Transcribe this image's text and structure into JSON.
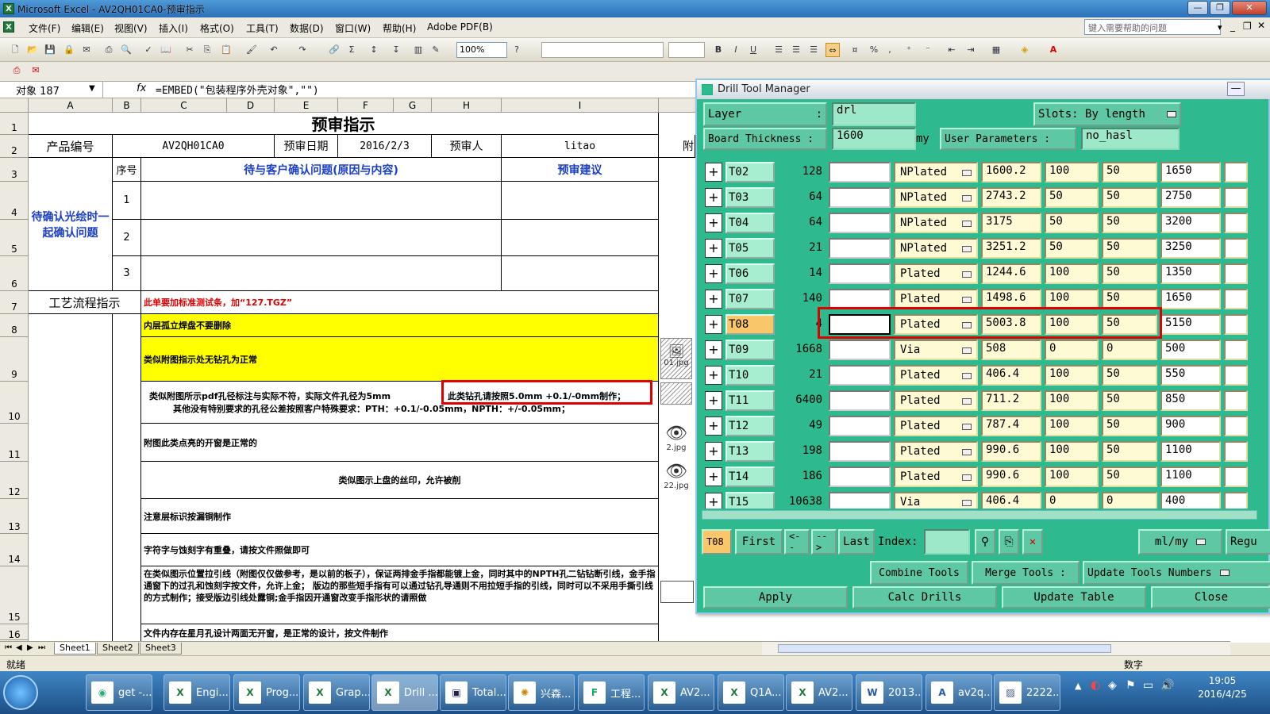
{
  "window": {
    "title": "Microsoft Excel - AV2QH01CA0-预审指示"
  },
  "menu": [
    "文件(F)",
    "编辑(E)",
    "视图(V)",
    "插入(I)",
    "格式(O)",
    "工具(T)",
    "数据(D)",
    "窗口(W)",
    "帮助(H)",
    "Adobe PDF(B)"
  ],
  "help_placeholder": "键入需要帮助的问题",
  "toolbar": {
    "zoom": "100%"
  },
  "formula_bar": {
    "name_box": "对象 187",
    "fx": "fx",
    "formula": "=EMBED(\"包装程序外壳对象\",\"\")"
  },
  "columns": [
    "A",
    "B",
    "C",
    "D",
    "E",
    "F",
    "G",
    "H",
    "I"
  ],
  "rows": [
    "1",
    "2",
    "3",
    "4",
    "5",
    "6",
    "7",
    "8",
    "9",
    "10",
    "11",
    "12",
    "13",
    "14",
    "15",
    "16"
  ],
  "sheet": {
    "title": "预审指示",
    "r2": {
      "label": "产品编号",
      "product": "AV2QH01CA0",
      "date_label": "预审日期",
      "date": "2016/2/3",
      "reviewer_label": "预审人",
      "reviewer": "litao",
      "cut": "附"
    },
    "r3": {
      "seq": "序号",
      "issues": "待与客户确认问题(原因与内容)",
      "advice": "预审建议"
    },
    "pending": "待确认光绘时一起确认问题",
    "seqs": [
      "1",
      "2",
      "3"
    ],
    "process_label": "工艺流程指示",
    "r7": "此单要加标准测试条，加“127.TGZ”",
    "r8": "内层孤立焊盘不要删除",
    "r9": "类似附图指示处无钻孔为正常",
    "r10a": "类似附图所示pdf孔径标注与实际不符，实际文件孔径为5mm",
    "r10b": "此类钻孔请按照5.0mm +0.1/-0mm制作；",
    "r10c": "其他没有特别要求的孔径公差按照客户特殊要求：PTH：+0.1/-0.05mm，NPTH：+/-0.05mm；",
    "r11": "附图此类点亮的开窗是正常的",
    "r12": "类似图示上盘的丝印，允许被削",
    "r13": "注意层标识按漏铜制作",
    "r14": "字符字与蚀刻字有重叠，请按文件照做即可",
    "r15": "在类似图示位置拉引线（附图仅仅做参考，是以前的板子），保证两排金手指都能镀上金，同时其中的NPTH孔二钻钻断引线，金手指通窗下的过孔和蚀刻字按文件，允许上金；  版边的那些短手指有可以通过钻孔导通则不用拉短手指的引线，同时可以不采用手撕引线的方式制作；接受版边引线处露铜;金手指因开通窗改变手指形状的请照做",
    "r16": "文件内存在星月孔设计两面无开窗，是正常的设计，按文件制作",
    "images": [
      "01.jpg",
      "2.jpg",
      "22.jpg"
    ]
  },
  "sheet_tabs": [
    "Sheet1",
    "Sheet2",
    "Sheet3"
  ],
  "status": {
    "left": "就绪",
    "right": "数字"
  },
  "dtm": {
    "title": "Drill Tool Manager",
    "layer_label": "Layer",
    "layer_value": "drl",
    "slots_label": "Slots:",
    "slots_value": "By length",
    "thickness_label": "Board Thickness :",
    "thickness_value": "1600",
    "thickness_unit": "my",
    "user_params_label": "User Parameters :",
    "user_params_value": "no_hasl",
    "tools": [
      {
        "name": "T02",
        "count": "128",
        "type": "NPlated",
        "size": "1600.2",
        "p": "100",
        "m": "50",
        "f": "1650"
      },
      {
        "name": "T03",
        "count": "64",
        "type": "NPlated",
        "size": "2743.2",
        "p": "50",
        "m": "50",
        "f": "2750"
      },
      {
        "name": "T04",
        "count": "64",
        "type": "NPlated",
        "size": "3175",
        "p": "50",
        "m": "50",
        "f": "3200"
      },
      {
        "name": "T05",
        "count": "21",
        "type": "NPlated",
        "size": "3251.2",
        "p": "50",
        "m": "50",
        "f": "3250"
      },
      {
        "name": "T06",
        "count": "14",
        "type": "Plated",
        "size": "1244.6",
        "p": "100",
        "m": "50",
        "f": "1350"
      },
      {
        "name": "T07",
        "count": "140",
        "type": "Plated",
        "size": "1498.6",
        "p": "100",
        "m": "50",
        "f": "1650"
      },
      {
        "name": "T08",
        "count": "4",
        "type": "Plated",
        "size": "5003.8",
        "p": "100",
        "m": "50",
        "f": "5150"
      },
      {
        "name": "T09",
        "count": "1668",
        "type": "Via",
        "size": "508",
        "p": "0",
        "m": "0",
        "f": "500"
      },
      {
        "name": "T10",
        "count": "21",
        "type": "Plated",
        "size": "406.4",
        "p": "100",
        "m": "50",
        "f": "550"
      },
      {
        "name": "T11",
        "count": "6400",
        "type": "Plated",
        "size": "711.2",
        "p": "100",
        "m": "50",
        "f": "850"
      },
      {
        "name": "T12",
        "count": "49",
        "type": "Plated",
        "size": "787.4",
        "p": "100",
        "m": "50",
        "f": "900"
      },
      {
        "name": "T13",
        "count": "198",
        "type": "Plated",
        "size": "990.6",
        "p": "100",
        "m": "50",
        "f": "1100"
      },
      {
        "name": "T14",
        "count": "186",
        "type": "Plated",
        "size": "990.6",
        "p": "100",
        "m": "50",
        "f": "1100"
      },
      {
        "name": "T15",
        "count": "10638",
        "type": "Via",
        "size": "406.4",
        "p": "0",
        "m": "0",
        "f": "400"
      }
    ],
    "nav": {
      "current": "T08",
      "first": "First",
      "prev": "<--",
      "next": "-->",
      "last": "Last",
      "index": "Index:",
      "unit": "ml/my",
      "regu": "Regu"
    },
    "actions": {
      "combine": "Combine Tools",
      "merge": "Merge Tools :",
      "update_numbers": "Update Tools Numbers",
      "apply": "Apply",
      "calc": "Calc Drills",
      "update_table": "Update Table",
      "close": "Close"
    }
  },
  "taskbar": [
    {
      "label": "get -..."
    },
    {
      "label": "Engi..."
    },
    {
      "label": "Prog..."
    },
    {
      "label": "Grap..."
    },
    {
      "label": "Drill ..."
    },
    {
      "label": "Total..."
    },
    {
      "label": "兴森..."
    },
    {
      "label": "工程..."
    },
    {
      "label": "AV2..."
    },
    {
      "label": "Q1A..."
    },
    {
      "label": "AV2..."
    },
    {
      "label": "2013..."
    },
    {
      "label": "av2q..."
    },
    {
      "label": "2222..."
    }
  ],
  "clock": {
    "time": "19:05",
    "date": "2016/4/25"
  },
  "colors": {
    "accent_red": "#e00000",
    "dtm_green": "#2fb98e",
    "yellow": "#ffff00",
    "blue_text": "#1a3fc8"
  }
}
